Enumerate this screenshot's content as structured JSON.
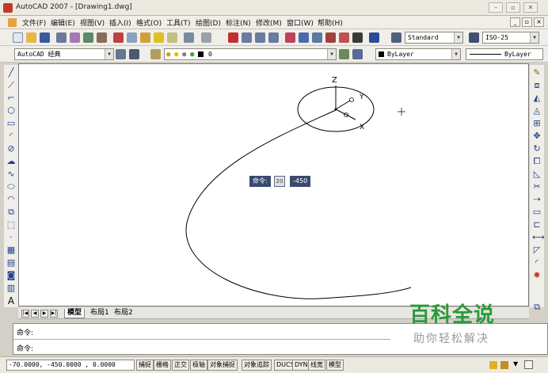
{
  "window": {
    "title": "AutoCAD 2007 - [Drawing1.dwg]",
    "minimize_glyph": "–",
    "maximize_glyph": "▫",
    "close_glyph": "✕"
  },
  "menu": {
    "items": [
      "文件(F)",
      "编辑(E)",
      "视图(V)",
      "插入(I)",
      "格式(O)",
      "工具(T)",
      "绘图(D)",
      "标注(N)",
      "修改(M)",
      "窗口(W)",
      "帮助(H)"
    ],
    "doc_minimize_glyph": "_",
    "doc_restore_glyph": "▫",
    "doc_close_glyph": "×"
  },
  "toolbar_standard": {
    "text_style": "Standard",
    "dim_style": "ISO-25"
  },
  "toolbar_layers": {
    "workspace": "AutoCAD 经典",
    "layer": "0",
    "color": "ByLayer",
    "linetype": "ByLayer"
  },
  "canvas": {
    "axis_z": "Z",
    "axis_y": "Y",
    "axis_x": "X"
  },
  "dynamic_input": {
    "label": "命令:",
    "field1": "20",
    "field2": "-450"
  },
  "tabs": {
    "nav": [
      "|◀",
      "◀",
      "▶",
      "▶|"
    ],
    "items": [
      "模型",
      "布局1",
      "布局2"
    ]
  },
  "command": {
    "line1": "命令:",
    "line2": "命令:"
  },
  "status": {
    "coords": "-70.0000,  -450.0000 , 0.0000",
    "buttons": [
      "捕捉",
      "栅格",
      "正交",
      "极轴",
      "对象捕捉",
      "对象追踪",
      "DUCS",
      "DYN",
      "线宽",
      "模型"
    ]
  },
  "watermark": {
    "main": "百科全说",
    "sub": "助你轻松解决"
  },
  "colors": {
    "accent_green": "#2a9a3a",
    "dyn_input_bg": "#3a4a6e"
  }
}
